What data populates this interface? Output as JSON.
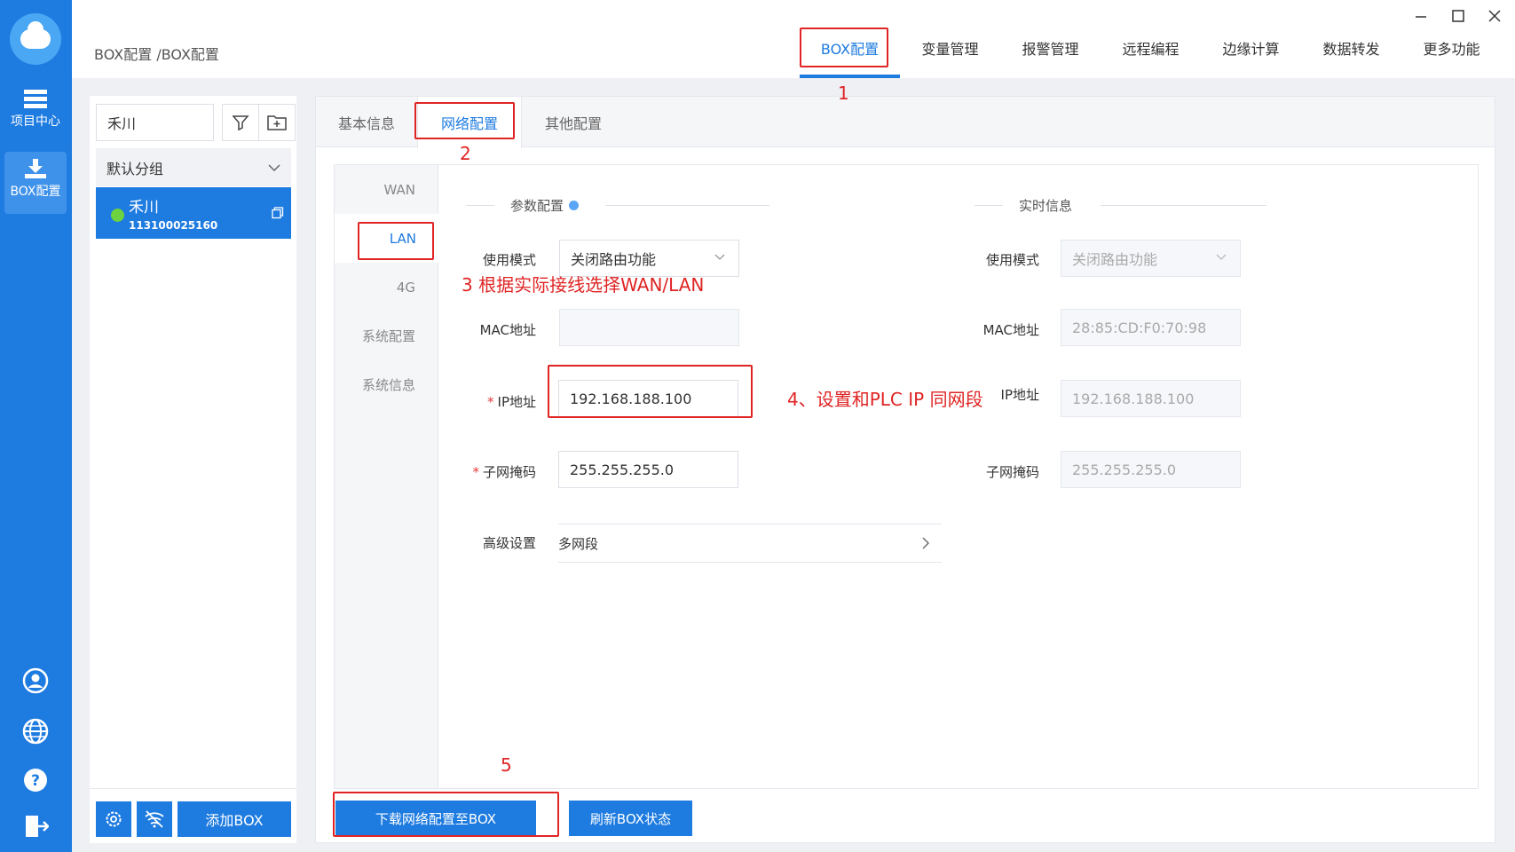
{
  "app": {
    "rail": {
      "items": [
        {
          "label": "项目中心",
          "icon": "list-icon"
        },
        {
          "label": "BOX配置",
          "icon": "download-icon",
          "active": true
        }
      ],
      "bottom_icons": [
        "user-icon",
        "globe-icon",
        "help-icon",
        "logout-icon"
      ]
    },
    "breadcrumb": "BOX配置 /BOX配置",
    "topnav": [
      "BOX配置",
      "变量管理",
      "报警管理",
      "远程编程",
      "边缘计算",
      "数据转发",
      "更多功能"
    ],
    "window_controls": [
      "minimize-icon",
      "maximize-icon",
      "close-icon"
    ]
  },
  "left_panel": {
    "search_value": "禾川",
    "group_label": "默认分组",
    "device": {
      "name": "禾川",
      "serial": "113100025160",
      "status_color": "#6dd23f"
    },
    "add_box_label": "添加BOX"
  },
  "main": {
    "subtabs": [
      "基本信息",
      "网络配置",
      "其他配置"
    ],
    "side_tabs": [
      "WAN",
      "LAN",
      "4G",
      "系统配置",
      "系统信息"
    ],
    "param_section": "参数配置",
    "realtime_section": "实时信息",
    "form": {
      "mode_label": "使用模式",
      "mode_value": "关闭路由功能",
      "mac_label": "MAC地址",
      "mac_value": "",
      "ip_label": "IP地址",
      "ip_value": "192.168.188.100",
      "mask_label": "子网掩码",
      "mask_value": "255.255.255.0",
      "adv_label": "高级设置",
      "adv_value": "多网段"
    },
    "realtime": {
      "mode_label": "使用模式",
      "mode_value": "关闭路由功能",
      "mac_label": "MAC地址",
      "mac_value": "28:85:CD:F0:70:98",
      "ip_label": "IP地址",
      "ip_value": "192.168.188.100",
      "mask_label": "子网掩码",
      "mask_value": "255.255.255.0"
    },
    "buttons": {
      "download": "下载网络配置至BOX",
      "refresh": "刷新BOX状态"
    }
  },
  "annotations": {
    "n1": "1",
    "n2": "2",
    "n3": "3 根据实际接线选择WAN/LAN",
    "n4": "4、设置和PLC IP 同网段",
    "n5": "5"
  },
  "colors": {
    "primary": "#1e7be0",
    "annotation": "#e02424",
    "rail": "#1e7be0"
  }
}
